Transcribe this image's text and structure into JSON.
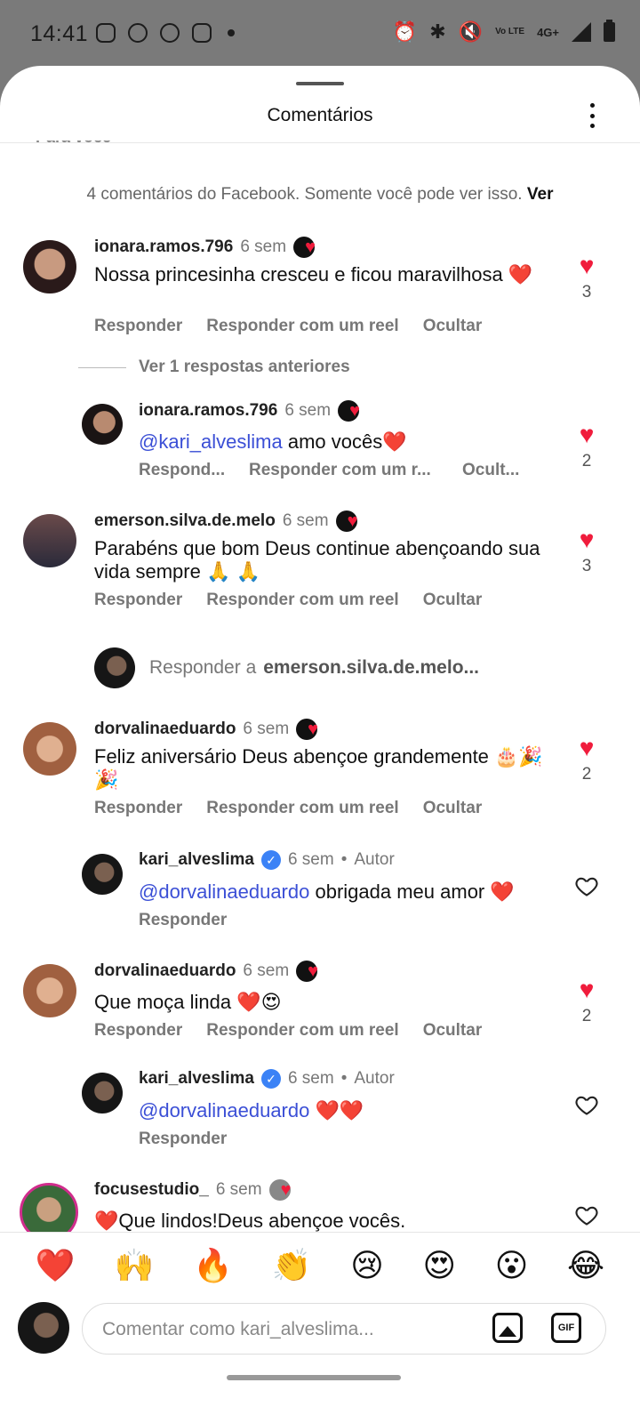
{
  "status_bar": {
    "time": "14:41",
    "network": "4G+",
    "volte": "Vo LTE"
  },
  "header": {
    "title": "Comentários",
    "cut_text": "Para você"
  },
  "fb_notice": {
    "text": "4 comentários do Facebook. Somente você pode ver isso.",
    "link": "Ver"
  },
  "comments": [
    {
      "user": "ionara.ramos.796",
      "time": "6 sem",
      "text": "Nossa princesinha cresceu e ficou maravilhosa ❤️",
      "actions": [
        "Responder",
        "Responder com um reel",
        "Ocultar"
      ],
      "likes": "3",
      "avatar_color": "#3a2a2a"
    },
    {
      "user": "ionara.ramos.796",
      "time": "6 sem",
      "mention": "@kari_alveslima",
      "text": "amo vocês❤️",
      "actions": [
        "Respond...",
        "Responder com um r...",
        "Ocult..."
      ],
      "likes": "2",
      "avatar_color": "#2a2020"
    },
    {
      "user": "emerson.silva.de.melo",
      "time": "6 sem",
      "text": "Parabéns que bom Deus continue abençoando sua vida sempre 🙏 🙏",
      "actions": [
        "Responder",
        "Responder com um reel",
        "Ocultar"
      ],
      "likes": "3",
      "avatar_color": "#5a3a3a"
    },
    {
      "user": "dorvalinaeduardo",
      "time": "6 sem",
      "text": "Feliz aniversário Deus abençoe grandemente 🎂🎉🎉",
      "actions": [
        "Responder",
        "Responder com um reel",
        "Ocultar"
      ],
      "likes": "2",
      "avatar_color": "#b07050"
    },
    {
      "user": "kari_alveslima",
      "time": "6 sem",
      "author": "Autor",
      "mention": "@dorvalinaeduardo",
      "text": "obrigada meu amor ❤️",
      "actions": [
        "Responder"
      ],
      "avatar_color": "#1e1e1e"
    },
    {
      "user": "dorvalinaeduardo",
      "time": "6 sem",
      "text": "Que moça linda ❤️😍",
      "actions": [
        "Responder",
        "Responder com um reel",
        "Ocultar"
      ],
      "likes": "2",
      "avatar_color": "#b07050"
    },
    {
      "user": "kari_alveslima",
      "time": "6 sem",
      "author": "Autor",
      "mention": "@dorvalinaeduardo",
      "text": "❤️❤️",
      "actions": [
        "Responder"
      ],
      "avatar_color": "#1e1e1e"
    },
    {
      "user": "focusestudio_",
      "time": "6 sem",
      "text": "❤️Que lindos!Deus abençoe vocês.",
      "avatar_color": "#3a6a3a"
    }
  ],
  "view_replies": "Ver 1 respostas anteriores",
  "reply_prompt": {
    "prefix": "Responder a",
    "target": "emerson.silva.de.melo..."
  },
  "emoji_bar": [
    "❤️",
    "🙌",
    "🔥",
    "👏",
    "😢",
    "😍",
    "😮",
    "😂"
  ],
  "input": {
    "placeholder": "Comentar como kari_alveslima...",
    "gif_label": "GIF"
  },
  "colors": {
    "heart_red": "#f01c3c",
    "mention_blue": "#3b4fd6",
    "verified_blue": "#3b82f6"
  }
}
